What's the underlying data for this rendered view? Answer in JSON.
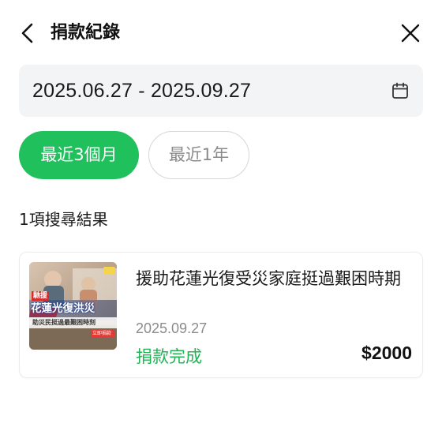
{
  "header": {
    "title": "捐款紀錄"
  },
  "filter": {
    "date_range": "2025.06.27 - 2025.09.27",
    "chips": [
      {
        "label": "最近3個月",
        "active": true
      },
      {
        "label": "最近1年",
        "active": false
      }
    ]
  },
  "results": {
    "count_text": "1項搜尋結果",
    "items": [
      {
        "title": "援助花蓮光復受災家庭挺過艱困時期",
        "date": "2025.09.27",
        "status": "捐款完成",
        "amount": "$2000",
        "thumbnail": {
          "tag": "馳援",
          "headline": "花蓮光復洪災",
          "subline": "助災民挺過最艱困時刻",
          "button": "立即捐款"
        }
      }
    ]
  },
  "colors": {
    "accent": "#20c05c",
    "status_green": "#20b455",
    "date_box_bg": "#f3f4f5"
  }
}
